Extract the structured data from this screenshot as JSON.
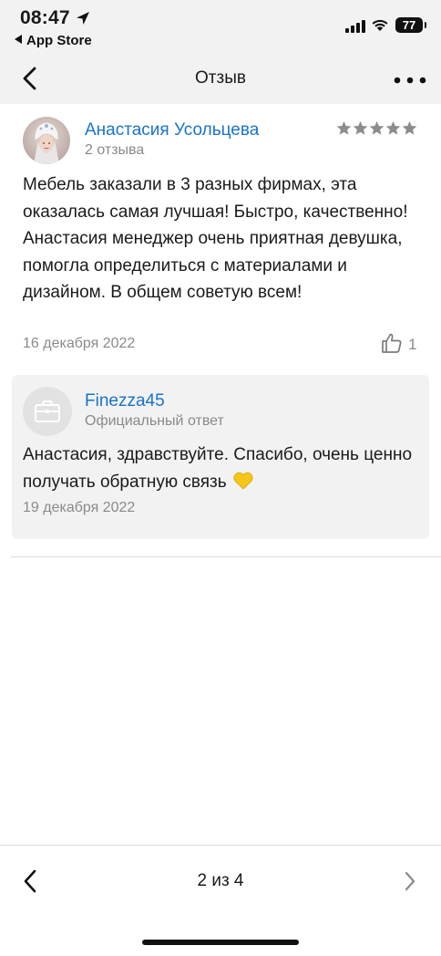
{
  "status_bar": {
    "time": "08:47",
    "back_app_label": "App Store",
    "battery": "77"
  },
  "navbar": {
    "title": "Отзыв"
  },
  "review": {
    "author": "Анастасия Усольцева",
    "author_reviews": "2 отзыва",
    "rating": 5,
    "text": "Мебель заказали в 3 разных фирмах, эта оказалась самая лучшая! Быстро, качественно! Анастасия менеджер очень приятная девушка, помогла определиться с материалами и дизайном. В общем советую всем!",
    "date": "16 декабря 2022",
    "likes": "1"
  },
  "reply": {
    "author": "Finezza45",
    "subtitle": "Официальный ответ",
    "text": "Анастасия, здравствуйте. Спасибо, очень ценно получать обратную связь",
    "date": "19 декабря 2022"
  },
  "pager": {
    "label": "2 из 4"
  },
  "colors": {
    "link_blue": "#1a73c9",
    "muted_gray": "#8a8a8a",
    "panel_gray": "#f2f2f2",
    "star_gray": "#8c8c8c",
    "heart_yellow": "#f5c518"
  },
  "icons": {
    "back": "chevron-left-icon",
    "more": "more-horizontal-icon",
    "like": "thumbs-up-icon",
    "reply_avatar": "briefcase-icon",
    "next": "chevron-right-icon"
  }
}
